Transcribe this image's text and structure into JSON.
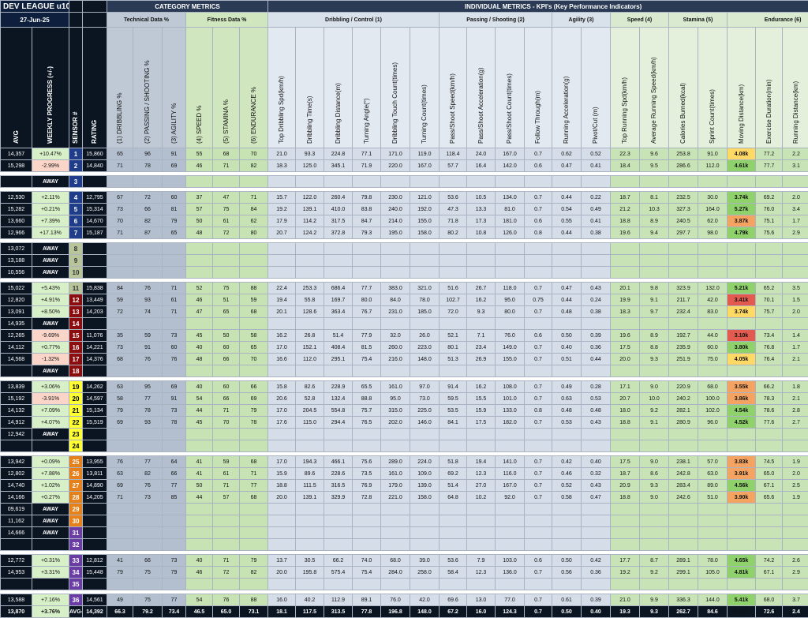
{
  "title": "DEV LEAGUE u10/11",
  "date": "27-Jun-25",
  "category_metrics": "CATEGORY METRICS",
  "technical_header": "Technical Data %",
  "fitness_header": "Fitness Data %",
  "individual_header": "INDIVIDUAL METRICS - KPI's (Key Performance Indicators)",
  "groups": {
    "dribbling": "Dribbling / Control (1)",
    "passing": "Passing / Shooting (2)",
    "agility": "Agility (3)",
    "speed": "Speed (4)",
    "stamina": "Stamina (5)",
    "endurance": "Endurance (6)"
  },
  "columns": {
    "avg": "AVG",
    "weekly": "WEEKLY PROGRESS (+/-)",
    "sensor": "SENSOR #",
    "rating": "RATING",
    "dribbling_pct": "(1) DRIBBLING %",
    "passing_pct": "(2) PASSING / SHOOTING %",
    "agility_pct": "(3) AGILITY %",
    "speed_pct": "(4) SPEED %",
    "stamina_pct": "(5) STAMINA %",
    "endurance_pct": "(6) ENDURANCE %",
    "k1": "Top Dribbling Spd(km/h)",
    "k2": "Dribbling Time(s)",
    "k3": "Dribbling Distance(m)",
    "k4": "Turning Angle(°)",
    "k5": "Dribbling Touch Count(times)",
    "k6": "Turning Count(times)",
    "k7": "Pass/Shoot Speed(km/h)",
    "k8": "Pass/Shoot Acceleration(g)",
    "k9": "Pass/Shoot Count(times)",
    "k10": "Follow Through(m)",
    "k11": "Running Acceleration(g)",
    "k12": "Pivot/Cut (m)",
    "k13": "Top Running Spd(km/h)",
    "k14": "Average Running Speed(km/h)",
    "k15": "Calories Burned(kcal)",
    "k16": "Sprint Count(times)",
    "k17": "Moving Distance(km)",
    "k18": "Exercise Duration(min)",
    "k19": "Running Distance(km)",
    "k20": "Running Time(min)"
  },
  "rows": [
    {
      "avg": "14,357",
      "wp": "+10.47%",
      "s": "1",
      "sc": "blue",
      "r": "15,860",
      "c": [
        "65",
        "96",
        "91",
        "55",
        "68",
        "70"
      ],
      "k": [
        "21.0",
        "93.3",
        "224.8",
        "77.1",
        "171.0",
        "119.0",
        "118.4",
        "24.0",
        "167.0",
        "0.7",
        "0.62",
        "0.52",
        "22.3",
        "9.6",
        "253.8",
        "91.0",
        "4.08k",
        "77.2",
        "2.2",
        "13.6"
      ],
      "mv": "yellow"
    },
    {
      "avg": "15,298",
      "wp": "-2.99%",
      "s": "2",
      "sc": "blue",
      "r": "14,840",
      "c": [
        "71",
        "78",
        "69",
        "46",
        "71",
        "82"
      ],
      "k": [
        "18.3",
        "125.0",
        "345.1",
        "71.9",
        "220.0",
        "167.0",
        "57.7",
        "16.4",
        "142.0",
        "0.6",
        "0.47",
        "0.41",
        "18.4",
        "9.5",
        "286.6",
        "112.0",
        "4.61k",
        "77.7",
        "3.1",
        "19.3"
      ],
      "mv": "green"
    },
    {
      "avg": "",
      "s": "3",
      "sc": "blue",
      "away": "AWAY"
    },
    {
      "avg": "12,530",
      "wp": "+2.11%",
      "s": "4",
      "sc": "blue",
      "r": "12,795",
      "c": [
        "67",
        "72",
        "60",
        "37",
        "47",
        "71"
      ],
      "k": [
        "15.7",
        "122.0",
        "260.4",
        "79.8",
        "230.0",
        "121.0",
        "53.6",
        "10.5",
        "134.0",
        "0.7",
        "0.44",
        "0.22",
        "18.7",
        "8.1",
        "232.5",
        "30.0",
        "3.74k",
        "69.2",
        "2.0",
        "14.6"
      ],
      "mv": "green"
    },
    {
      "avg": "15,282",
      "wp": "+0.21%",
      "s": "5",
      "sc": "blue",
      "r": "15,314",
      "c": [
        "73",
        "66",
        "81",
        "57",
        "75",
        "84"
      ],
      "k": [
        "19.2",
        "139.1",
        "410.0",
        "83.8",
        "240.0",
        "192.0",
        "47.3",
        "13.3",
        "81.0",
        "0.7",
        "0.54",
        "0.49",
        "21.2",
        "10.3",
        "327.3",
        "164.0",
        "5.27k",
        "76.0",
        "3.4",
        "19.8"
      ],
      "mv": "green"
    },
    {
      "avg": "13,660",
      "wp": "+7.39%",
      "s": "6",
      "sc": "blue",
      "r": "14,670",
      "c": [
        "70",
        "82",
        "79",
        "50",
        "61",
        "62"
      ],
      "k": [
        "17.9",
        "114.2",
        "317.5",
        "84.7",
        "214.0",
        "155.0",
        "71.8",
        "17.3",
        "181.0",
        "0.6",
        "0.55",
        "0.41",
        "18.8",
        "8.9",
        "240.5",
        "62.0",
        "3.87k",
        "75.1",
        "1.7",
        "10.2"
      ],
      "mv": "orange"
    },
    {
      "avg": "12,966",
      "wp": "+17.13%",
      "s": "7",
      "sc": "blue",
      "r": "15,187",
      "c": [
        "71",
        "87",
        "65",
        "48",
        "72",
        "80"
      ],
      "k": [
        "20.7",
        "124.2",
        "372.8",
        "79.3",
        "195.0",
        "158.0",
        "80.2",
        "10.8",
        "126.0",
        "0.8",
        "0.44",
        "0.38",
        "19.6",
        "9.4",
        "297.7",
        "98.0",
        "4.79k",
        "75.6",
        "2.9",
        "18.2"
      ],
      "mv": "green"
    },
    {
      "avg": "13,072",
      "s": "8",
      "sc": "olive",
      "away": "AWAY"
    },
    {
      "avg": "13,188",
      "s": "9",
      "sc": "olive",
      "away": "AWAY"
    },
    {
      "avg": "10,556",
      "s": "10",
      "sc": "olive",
      "away": "AWAY"
    },
    {
      "avg": "15,022",
      "wp": "+5.43%",
      "s": "11",
      "sc": "olive",
      "r": "15,838",
      "c": [
        "84",
        "76",
        "71",
        "52",
        "75",
        "88"
      ],
      "k": [
        "22.4",
        "253.3",
        "686.4",
        "77.7",
        "383.0",
        "321.0",
        "51.6",
        "26.7",
        "118.0",
        "0.7",
        "0.47",
        "0.43",
        "20.1",
        "9.8",
        "323.9",
        "132.0",
        "5.21k",
        "65.2",
        "3.5",
        "21.7"
      ],
      "mv": "green"
    },
    {
      "avg": "12,820",
      "wp": "+4.91%",
      "s": "12",
      "sc": "red",
      "r": "13,449",
      "c": [
        "59",
        "93",
        "61",
        "46",
        "51",
        "59"
      ],
      "k": [
        "19.4",
        "55.8",
        "169.7",
        "80.0",
        "84.0",
        "78.0",
        "102.7",
        "16.2",
        "95.0",
        "0.75",
        "0.44",
        "0.24",
        "19.9",
        "9.1",
        "211.7",
        "42.0",
        "3.41k",
        "70.1",
        "1.5",
        "9.7"
      ],
      "mv": "red"
    },
    {
      "avg": "13,091",
      "wp": "+8.50%",
      "s": "13",
      "sc": "red",
      "r": "14,203",
      "c": [
        "72",
        "74",
        "71",
        "47",
        "65",
        "68"
      ],
      "k": [
        "20.1",
        "128.6",
        "363.4",
        "76.7",
        "231.0",
        "185.0",
        "72.0",
        "9.3",
        "80.0",
        "0.7",
        "0.48",
        "0.38",
        "18.3",
        "9.7",
        "232.4",
        "83.0",
        "3.74k",
        "75.7",
        "2.0",
        "12.6"
      ],
      "mv": "yellow"
    },
    {
      "avg": "14,935",
      "s": "14",
      "sc": "red",
      "away": "AWAY"
    },
    {
      "avg": "12,265",
      "wp": "-9.69%",
      "s": "15",
      "sc": "red",
      "r": "11,076",
      "c": [
        "35",
        "59",
        "73",
        "45",
        "50",
        "58"
      ],
      "k": [
        "16.2",
        "26.8",
        "51.4",
        "77.9",
        "32.0",
        "26.0",
        "52.1",
        "7.1",
        "76.0",
        "0.6",
        "0.50",
        "0.39",
        "19.6",
        "8.9",
        "192.7",
        "44.0",
        "3.10k",
        "73.4",
        "1.4",
        "9.3"
      ],
      "mv": "red"
    },
    {
      "avg": "14,112",
      "wp": "+0.77%",
      "s": "16",
      "sc": "red",
      "r": "14,221",
      "c": [
        "73",
        "91",
        "60",
        "40",
        "60",
        "65"
      ],
      "k": [
        "17.0",
        "152.1",
        "408.4",
        "81.5",
        "260.0",
        "223.0",
        "80.1",
        "23.4",
        "149.0",
        "0.7",
        "0.40",
        "0.36",
        "17.5",
        "8.8",
        "235.9",
        "60.0",
        "3.80k",
        "76.8",
        "1.7",
        "11.8"
      ],
      "mv": "green"
    },
    {
      "avg": "14,568",
      "wp": "-1.32%",
      "s": "17",
      "sc": "red",
      "r": "14,376",
      "c": [
        "68",
        "76",
        "76",
        "48",
        "66",
        "70"
      ],
      "k": [
        "16.6",
        "112.0",
        "295.1",
        "75.4",
        "216.0",
        "148.0",
        "51.3",
        "26.9",
        "155.0",
        "0.7",
        "0.51",
        "0.44",
        "20.0",
        "9.3",
        "251.9",
        "75.0",
        "4.05k",
        "76.4",
        "2.1",
        "13.6"
      ],
      "mv": "yellow"
    },
    {
      "avg": "",
      "s": "18",
      "sc": "red",
      "away": "AWAY"
    },
    {
      "avg": "13,839",
      "wp": "+3.06%",
      "s": "19",
      "sc": "yellow",
      "r": "14,262",
      "c": [
        "63",
        "95",
        "69",
        "40",
        "60",
        "66"
      ],
      "k": [
        "15.8",
        "82.6",
        "228.9",
        "65.5",
        "161.0",
        "97.0",
        "91.4",
        "16.2",
        "108.0",
        "0.7",
        "0.49",
        "0.28",
        "17.1",
        "9.0",
        "220.9",
        "68.0",
        "3.55k",
        "66.2",
        "1.8",
        "12.0"
      ],
      "mv": "orange"
    },
    {
      "avg": "15,192",
      "wp": "-3.91%",
      "s": "20",
      "sc": "yellow",
      "r": "14,597",
      "c": [
        "58",
        "77",
        "91",
        "54",
        "66",
        "69"
      ],
      "k": [
        "20.6",
        "52.8",
        "132.4",
        "88.8",
        "95.0",
        "73.0",
        "59.5",
        "15.5",
        "101.0",
        "0.7",
        "0.63",
        "0.53",
        "20.7",
        "10.0",
        "240.2",
        "100.0",
        "3.86k",
        "78.3",
        "2.1",
        "12.8"
      ],
      "mv": "orange"
    },
    {
      "avg": "14,132",
      "wp": "+7.09%",
      "s": "21",
      "sc": "yellow",
      "r": "15,134",
      "c": [
        "79",
        "78",
        "73",
        "44",
        "71",
        "79"
      ],
      "k": [
        "17.0",
        "204.5",
        "554.8",
        "75.7",
        "315.0",
        "225.0",
        "53.5",
        "15.9",
        "133.0",
        "0.8",
        "0.48",
        "0.48",
        "18.0",
        "9.2",
        "282.1",
        "102.0",
        "4.54k",
        "78.6",
        "2.8",
        "18.2"
      ],
      "mv": "green"
    },
    {
      "avg": "14,912",
      "wp": "+4.07%",
      "s": "22",
      "sc": "yellow",
      "r": "15,519",
      "c": [
        "69",
        "93",
        "78",
        "45",
        "70",
        "78"
      ],
      "k": [
        "17.6",
        "115.0",
        "294.4",
        "76.5",
        "202.0",
        "146.0",
        "84.1",
        "17.5",
        "182.0",
        "0.7",
        "0.53",
        "0.43",
        "18.8",
        "9.1",
        "280.9",
        "96.0",
        "4.52k",
        "77.6",
        "2.7",
        "17.7"
      ],
      "mv": "green"
    },
    {
      "avg": "12,942",
      "s": "23",
      "sc": "yellow",
      "away": "AWAY"
    },
    {
      "avg": "",
      "s": "24",
      "sc": "yellow",
      "away": ""
    },
    {
      "avg": "13,942",
      "wp": "+0.09%",
      "s": "25",
      "sc": "orange",
      "r": "13,955",
      "c": [
        "76",
        "77",
        "64",
        "41",
        "59",
        "68"
      ],
      "k": [
        "17.0",
        "194.3",
        "466.1",
        "75.6",
        "289.0",
        "224.0",
        "51.8",
        "19.4",
        "141.0",
        "0.7",
        "0.42",
        "0.40",
        "17.5",
        "9.0",
        "238.1",
        "57.0",
        "3.83k",
        "74.5",
        "1.9",
        "12.9"
      ],
      "mv": "orange"
    },
    {
      "avg": "12,802",
      "wp": "+7.88%",
      "s": "26",
      "sc": "orange",
      "r": "13,811",
      "c": [
        "63",
        "82",
        "66",
        "41",
        "61",
        "71"
      ],
      "k": [
        "15.9",
        "89.6",
        "228.6",
        "73.5",
        "161.0",
        "109.0",
        "69.2",
        "12.3",
        "116.0",
        "0.7",
        "0.46",
        "0.32",
        "18.7",
        "8.6",
        "242.8",
        "63.0",
        "3.91k",
        "65.0",
        "2.0",
        "14.2"
      ],
      "mv": "orange"
    },
    {
      "avg": "14,740",
      "wp": "+1.02%",
      "s": "27",
      "sc": "orange",
      "r": "14,890",
      "c": [
        "69",
        "76",
        "77",
        "50",
        "71",
        "77"
      ],
      "k": [
        "18.8",
        "111.5",
        "316.5",
        "76.9",
        "179.0",
        "139.0",
        "51.4",
        "27.0",
        "167.0",
        "0.7",
        "0.52",
        "0.43",
        "20.9",
        "9.3",
        "283.4",
        "89.0",
        "4.56k",
        "67.1",
        "2.5",
        "16.2"
      ],
      "mv": "green"
    },
    {
      "avg": "14,166",
      "wp": "+0.27%",
      "s": "28",
      "sc": "orange",
      "r": "14,205",
      "c": [
        "71",
        "73",
        "85",
        "44",
        "57",
        "68"
      ],
      "k": [
        "20.0",
        "139.1",
        "329.9",
        "72.8",
        "221.0",
        "158.0",
        "64.8",
        "10.2",
        "92.0",
        "0.7",
        "0.58",
        "0.47",
        "18.8",
        "9.0",
        "242.6",
        "51.0",
        "3.90k",
        "65.6",
        "1.9",
        "12.5"
      ],
      "mv": "orange"
    },
    {
      "avg": "09,619",
      "s": "29",
      "sc": "orange",
      "away": "AWAY"
    },
    {
      "avg": "11,162",
      "s": "30",
      "sc": "orange",
      "away": "AWAY"
    },
    {
      "avg": "14,666",
      "s": "31",
      "sc": "purple",
      "away": "AWAY"
    },
    {
      "avg": "",
      "s": "32",
      "sc": "purple",
      "away": ""
    },
    {
      "avg": "12,772",
      "wp": "+0.31%",
      "s": "33",
      "sc": "purple",
      "r": "12,812",
      "c": [
        "41",
        "66",
        "73",
        "40",
        "71",
        "79"
      ],
      "k": [
        "13.7",
        "30.5",
        "66.2",
        "74.0",
        "68.0",
        "39.0",
        "53.6",
        "7.9",
        "103.0",
        "0.6",
        "0.50",
        "0.42",
        "17.7",
        "8.7",
        "289.1",
        "78.0",
        "4.65k",
        "74.2",
        "2.6",
        "18.0"
      ],
      "mv": "green"
    },
    {
      "avg": "14,953",
      "wp": "+3.31%",
      "s": "34",
      "sc": "purple",
      "r": "15,448",
      "c": [
        "79",
        "75",
        "79",
        "46",
        "72",
        "82"
      ],
      "k": [
        "20.0",
        "195.8",
        "575.4",
        "75.4",
        "284.0",
        "258.0",
        "58.4",
        "12.3",
        "136.0",
        "0.7",
        "0.56",
        "0.36",
        "19.2",
        "9.2",
        "299.1",
        "105.0",
        "4.81k",
        "67.1",
        "2.9",
        "18.7"
      ],
      "mv": "green"
    },
    {
      "avg": "",
      "s": "35",
      "sc": "purple",
      "away": ""
    },
    {
      "avg": "13,588",
      "wp": "+7.16%",
      "s": "36",
      "sc": "purple",
      "r": "14,561",
      "c": [
        "49",
        "75",
        "77",
        "54",
        "76",
        "88"
      ],
      "k": [
        "16.0",
        "40.2",
        "112.9",
        "89.1",
        "76.0",
        "42.0",
        "69.6",
        "13.0",
        "77.0",
        "0.7",
        "0.61",
        "0.39",
        "21.0",
        "9.9",
        "336.3",
        "144.0",
        "5.41k",
        "68.0",
        "3.7",
        "22.1"
      ],
      "mv": "green"
    }
  ],
  "footer": {
    "avg": "13,870",
    "wp": "+3.76%",
    "s": "AVG->",
    "r": "14,392",
    "c": [
      "66.3",
      "79.2",
      "73.4",
      "46.5",
      "65.0",
      "73.1"
    ],
    "k": [
      "18.1",
      "117.5",
      "313.5",
      "77.8",
      "196.8",
      "148.0",
      "67.2",
      "16.0",
      "124.3",
      "0.7",
      "0.50",
      "0.40",
      "19.3",
      "9.3",
      "262.7",
      "84.6",
      "4.23k",
      "72.6",
      "2.4",
      "15.2"
    ]
  },
  "colors": {
    "navy": "#0b1522",
    "sensor_blue": "#1f3d8a",
    "sensor_olive": "#b8c49a",
    "sensor_red": "#8b0d0d",
    "sensor_yellow": "#ffff33",
    "sensor_orange": "#e6801a",
    "sensor_purple": "#6a3da5"
  }
}
